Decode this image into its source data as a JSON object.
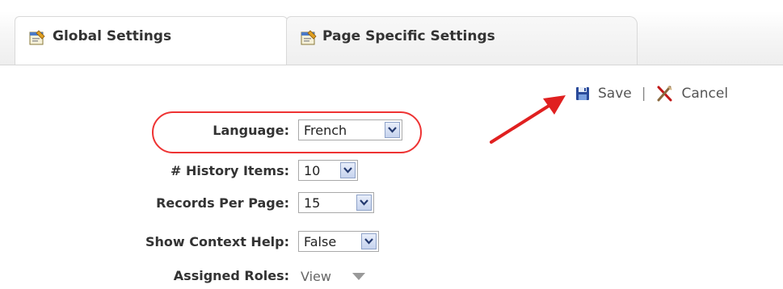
{
  "tabs": [
    {
      "label": "Global Settings",
      "icon": "settings-page-icon"
    },
    {
      "label": "Page Specific Settings",
      "icon": "settings-page-icon"
    }
  ],
  "actions": {
    "save_label": "Save",
    "separator": "|",
    "cancel_label": "Cancel",
    "save_icon": "floppy-disk-icon",
    "cancel_icon": "cancel-x-icon"
  },
  "settings": {
    "language": {
      "label": "Language:",
      "value": "French"
    },
    "history_items": {
      "label": "# History Items:",
      "value": "10"
    },
    "records_per_page": {
      "label": "Records Per Page:",
      "value": "15"
    },
    "show_context_help": {
      "label": "Show Context Help:",
      "value": "False"
    },
    "assigned_roles": {
      "label": "Assigned Roles:",
      "value": "View"
    }
  },
  "colors": {
    "highlight": "#e33333",
    "arrow": "#e02020",
    "select_button": "#c6d3ee"
  }
}
